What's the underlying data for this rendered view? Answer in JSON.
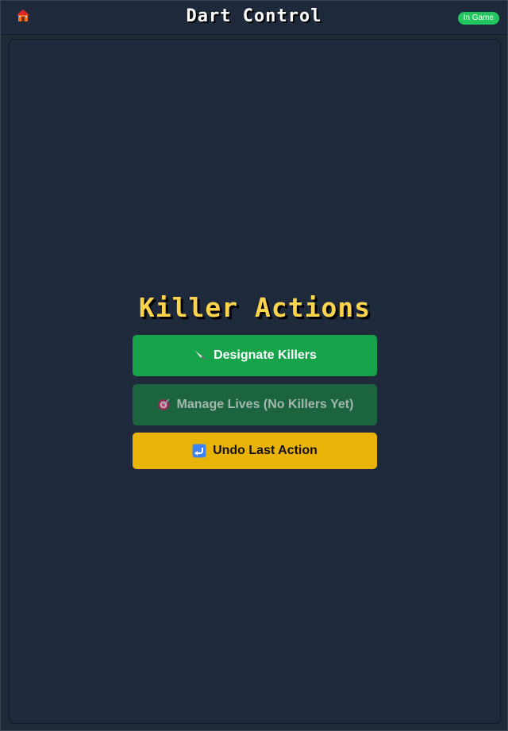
{
  "header": {
    "home_icon": "house-icon",
    "title": "Dart Control",
    "status": "In Game"
  },
  "main": {
    "section_title": "Killer Actions",
    "buttons": {
      "designate": {
        "label": "Designate Killers",
        "icon": "knife-icon"
      },
      "lives": {
        "label": "Manage Lives (No Killers Yet)",
        "icon": "target-icon",
        "disabled": true
      },
      "undo": {
        "label": "Undo Last Action",
        "icon": "undo-arrow-icon"
      }
    }
  },
  "colors": {
    "status_badge": "#22c55e",
    "title_accent": "#fcd34d",
    "designate": "#16a34a",
    "lives_disabled": "#1c6440",
    "undo": "#eab308"
  }
}
